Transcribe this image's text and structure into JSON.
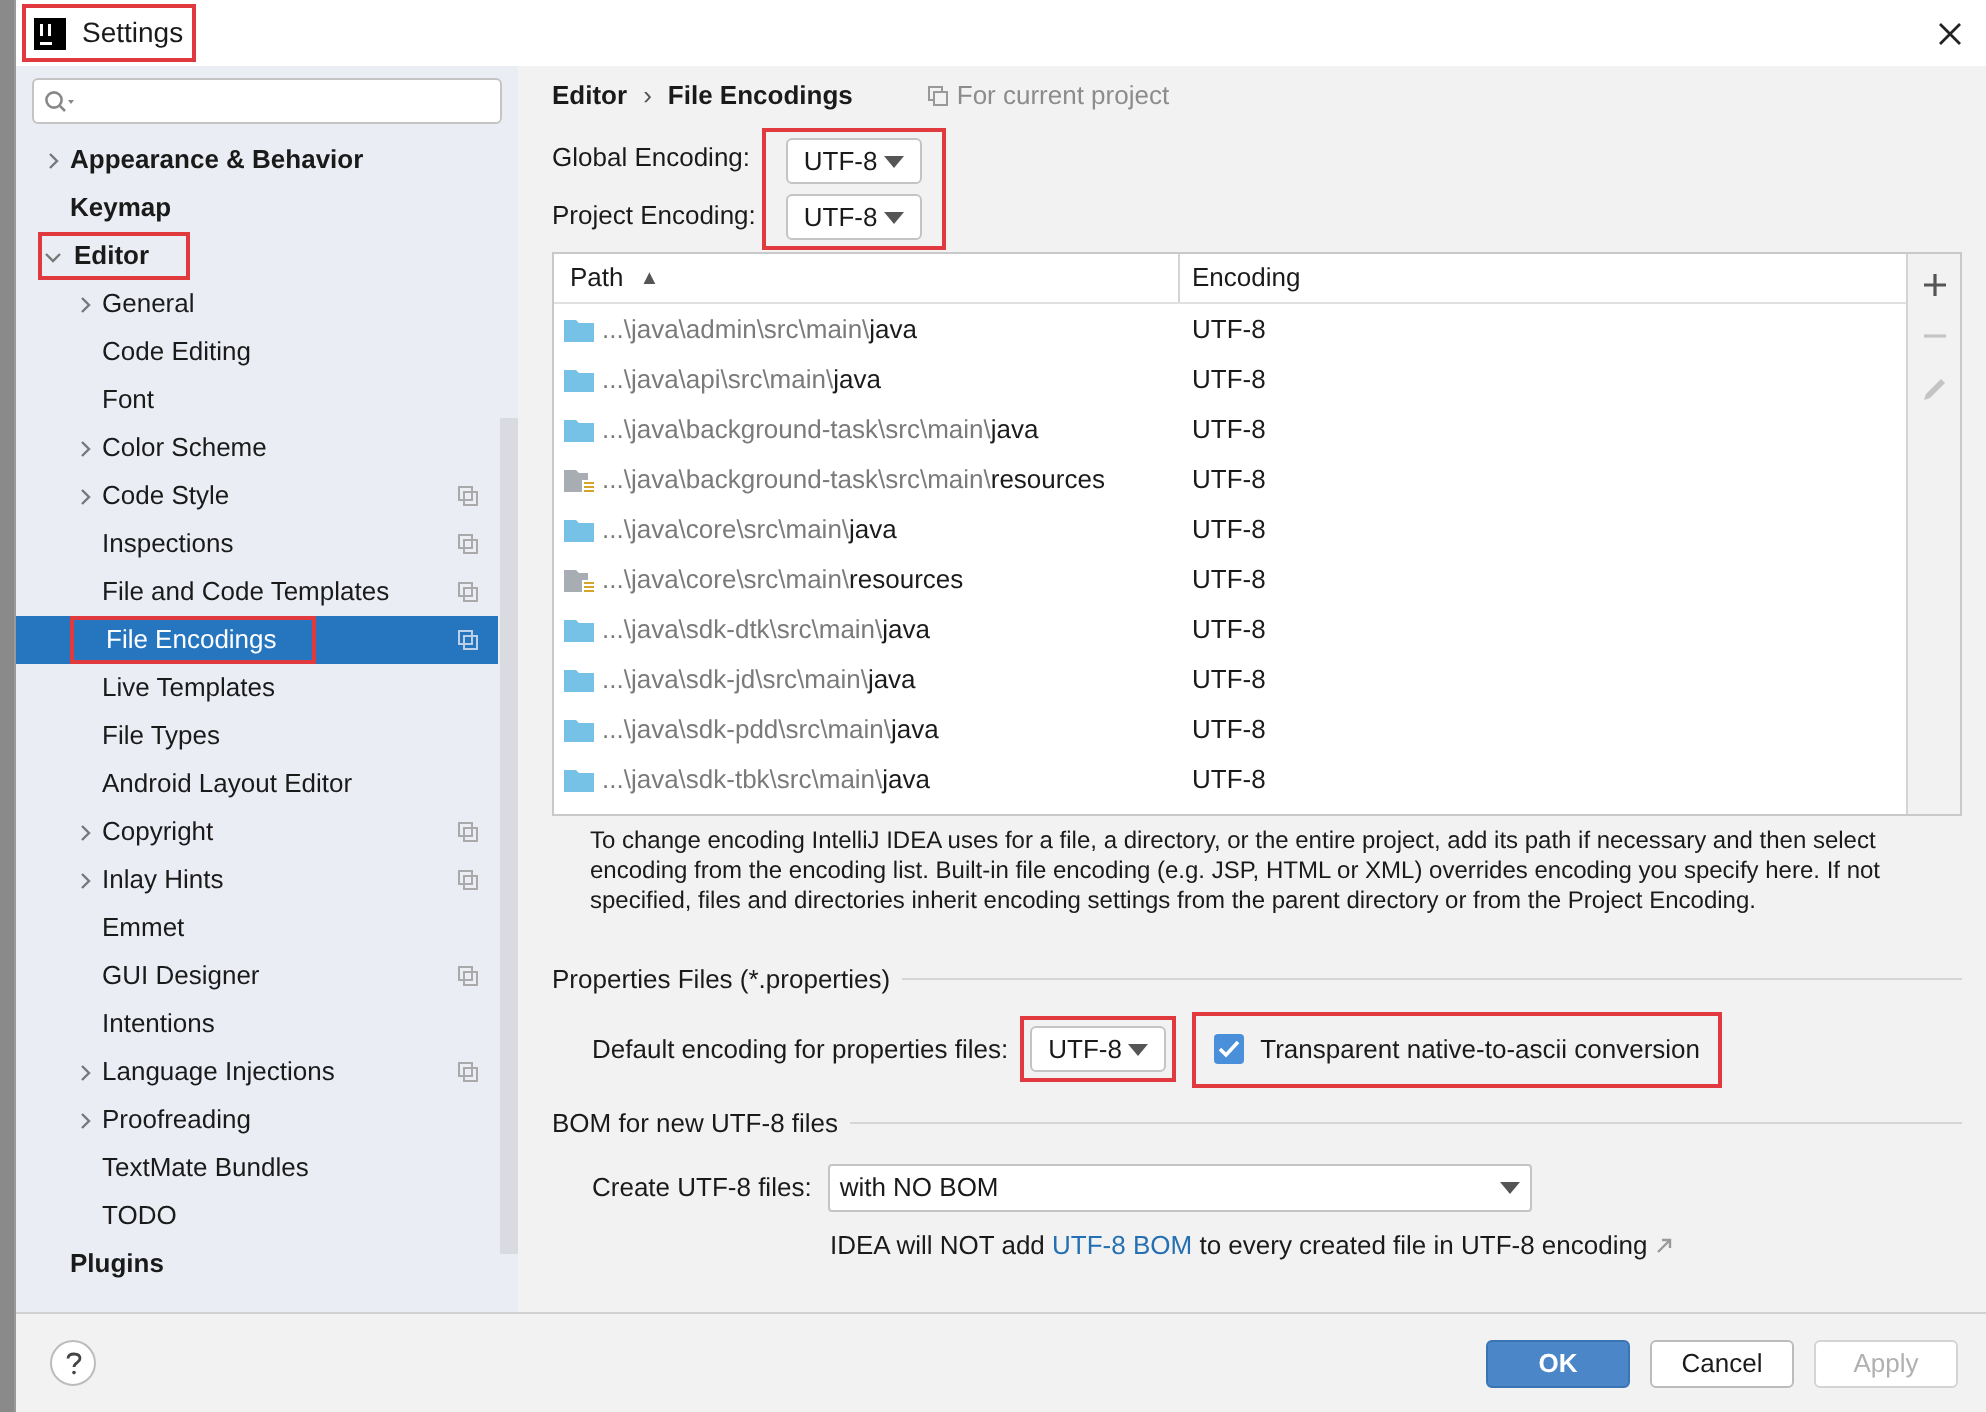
{
  "window": {
    "title": "Settings",
    "highlighted": true
  },
  "sidebar": {
    "items": [
      {
        "label": "Appearance & Behavior",
        "bold": true,
        "expanded": false,
        "expandable": true,
        "selected": false,
        "highlighted": false,
        "shared": false
      },
      {
        "label": "Keymap",
        "bold": true,
        "expandable": false,
        "selected": false,
        "highlighted": false,
        "shared": false
      },
      {
        "label": "Editor",
        "bold": true,
        "expandable": true,
        "expanded": true,
        "selected": false,
        "highlighted": true,
        "shared": false,
        "children": [
          {
            "label": "General",
            "expandable": true,
            "expanded": false,
            "selected": false,
            "highlighted": false,
            "shared": false
          },
          {
            "label": "Code Editing",
            "expandable": false,
            "selected": false,
            "highlighted": false,
            "shared": false
          },
          {
            "label": "Font",
            "expandable": false,
            "selected": false,
            "highlighted": false,
            "shared": false
          },
          {
            "label": "Color Scheme",
            "expandable": true,
            "expanded": false,
            "selected": false,
            "highlighted": false,
            "shared": false
          },
          {
            "label": "Code Style",
            "expandable": true,
            "expanded": false,
            "selected": false,
            "highlighted": false,
            "shared": true
          },
          {
            "label": "Inspections",
            "expandable": false,
            "selected": false,
            "highlighted": false,
            "shared": true
          },
          {
            "label": "File and Code Templates",
            "expandable": false,
            "selected": false,
            "highlighted": false,
            "shared": true
          },
          {
            "label": "File Encodings",
            "expandable": false,
            "selected": true,
            "highlighted": true,
            "shared": true
          },
          {
            "label": "Live Templates",
            "expandable": false,
            "selected": false,
            "highlighted": false,
            "shared": false
          },
          {
            "label": "File Types",
            "expandable": false,
            "selected": false,
            "highlighted": false,
            "shared": false
          },
          {
            "label": "Android Layout Editor",
            "expandable": false,
            "selected": false,
            "highlighted": false,
            "shared": false
          },
          {
            "label": "Copyright",
            "expandable": true,
            "expanded": false,
            "selected": false,
            "highlighted": false,
            "shared": true
          },
          {
            "label": "Inlay Hints",
            "expandable": true,
            "expanded": false,
            "selected": false,
            "highlighted": false,
            "shared": true
          },
          {
            "label": "Emmet",
            "expandable": false,
            "selected": false,
            "highlighted": false,
            "shared": false
          },
          {
            "label": "GUI Designer",
            "expandable": false,
            "selected": false,
            "highlighted": false,
            "shared": true
          },
          {
            "label": "Intentions",
            "expandable": false,
            "selected": false,
            "highlighted": false,
            "shared": false
          },
          {
            "label": "Language Injections",
            "expandable": true,
            "expanded": false,
            "selected": false,
            "highlighted": false,
            "shared": true
          },
          {
            "label": "Proofreading",
            "expandable": true,
            "expanded": false,
            "selected": false,
            "highlighted": false,
            "shared": false
          },
          {
            "label": "TextMate Bundles",
            "expandable": false,
            "selected": false,
            "highlighted": false,
            "shared": false
          },
          {
            "label": "TODO",
            "expandable": false,
            "selected": false,
            "highlighted": false,
            "shared": false
          }
        ]
      },
      {
        "label": "Plugins",
        "bold": true,
        "expandable": false,
        "selected": false,
        "highlighted": false,
        "shared": false
      }
    ]
  },
  "breadcrumb": {
    "parent": "Editor",
    "separator": "›",
    "current": "File Encodings",
    "scope": "For current project"
  },
  "encodings": {
    "highlighted": true,
    "fields": [
      {
        "label": "Global Encoding:",
        "value": "UTF-8"
      },
      {
        "label": "Project Encoding:",
        "value": "UTF-8"
      }
    ]
  },
  "table": {
    "columns": [
      {
        "label": "Path",
        "sort": "▲"
      },
      {
        "label": "Encoding"
      }
    ],
    "rows": [
      {
        "kind": "source",
        "path_prefix": "...\\java\\admin\\src\\main\\",
        "path_name": "java",
        "encoding": "UTF-8"
      },
      {
        "kind": "source",
        "path_prefix": "...\\java\\api\\src\\main\\",
        "path_name": "java",
        "encoding": "UTF-8"
      },
      {
        "kind": "source",
        "path_prefix": "...\\java\\background-task\\src\\main\\",
        "path_name": "java",
        "encoding": "UTF-8"
      },
      {
        "kind": "resources",
        "path_prefix": "...\\java\\background-task\\src\\main\\",
        "path_name": "resources",
        "encoding": "UTF-8"
      },
      {
        "kind": "source",
        "path_prefix": "...\\java\\core\\src\\main\\",
        "path_name": "java",
        "encoding": "UTF-8"
      },
      {
        "kind": "resources",
        "path_prefix": "...\\java\\core\\src\\main\\",
        "path_name": "resources",
        "encoding": "UTF-8"
      },
      {
        "kind": "source",
        "path_prefix": "...\\java\\sdk-dtk\\src\\main\\",
        "path_name": "java",
        "encoding": "UTF-8"
      },
      {
        "kind": "source",
        "path_prefix": "...\\java\\sdk-jd\\src\\main\\",
        "path_name": "java",
        "encoding": "UTF-8"
      },
      {
        "kind": "source",
        "path_prefix": "...\\java\\sdk-pdd\\src\\main\\",
        "path_name": "java",
        "encoding": "UTF-8"
      },
      {
        "kind": "source",
        "path_prefix": "...\\java\\sdk-tbk\\src\\main\\",
        "path_name": "java",
        "encoding": "UTF-8"
      }
    ],
    "tools": [
      {
        "kind": "add",
        "disabled": false
      },
      {
        "kind": "remove",
        "disabled": true
      },
      {
        "kind": "edit",
        "disabled": true
      }
    ]
  },
  "help_text": "To change encoding IntelliJ IDEA uses for a file, a directory, or the entire project, add its path if necessary and then select encoding from the encoding list. Built-in file encoding (e.g. JSP, HTML or XML) overrides encoding you specify here. If not specified, files and directories inherit encoding settings from the parent directory or from the Project Encoding.",
  "properties": {
    "title": "Properties Files (*.properties)",
    "label": "Default encoding for properties files:",
    "value": "UTF-8",
    "value_highlighted": true,
    "checkbox": {
      "label": "Transparent native-to-ascii conversion",
      "checked": true,
      "highlighted": true
    }
  },
  "bom": {
    "title": "BOM for new UTF-8 files",
    "label": "Create UTF-8 files:",
    "value": "with NO BOM",
    "note_before": "IDEA will NOT add",
    "link": "UTF-8 BOM",
    "note_after": "to every created file in UTF-8 encoding"
  },
  "buttons": [
    {
      "label": "OK",
      "kind": "primary",
      "disabled": false
    },
    {
      "label": "Cancel",
      "kind": "normal",
      "disabled": false
    },
    {
      "label": "Apply",
      "kind": "normal",
      "disabled": true
    }
  ]
}
